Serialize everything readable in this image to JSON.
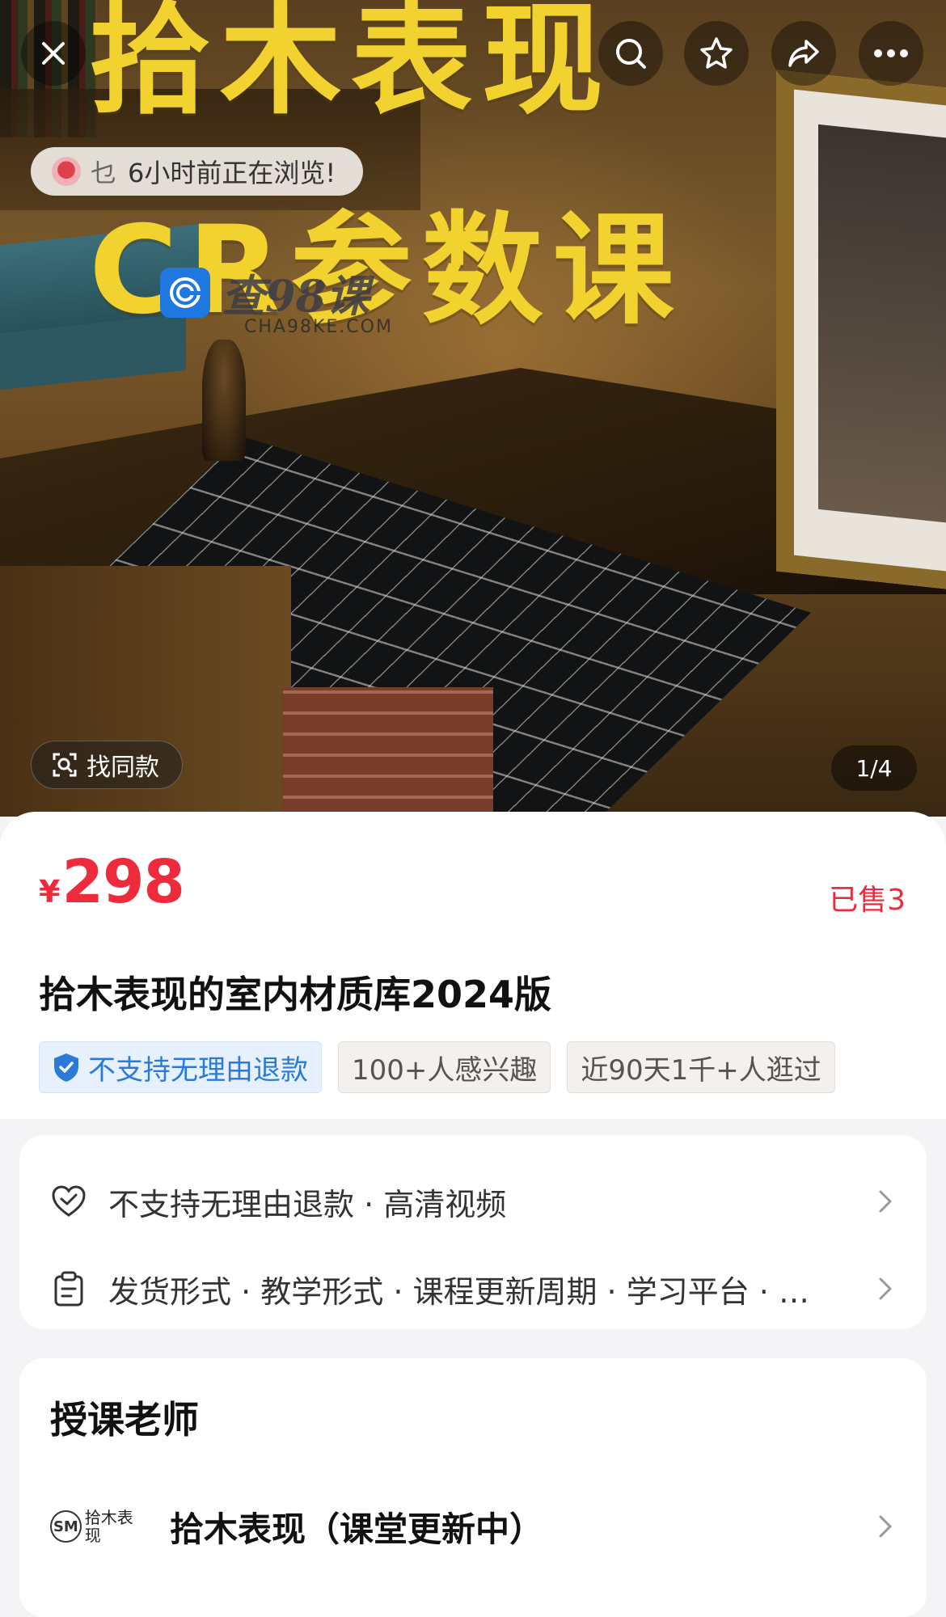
{
  "hero": {
    "title_line1": "拾木表现",
    "title_line2": "CR参数课",
    "watermark_text": "查98课",
    "watermark_url": "CHA98KE.COM",
    "browse_user": "乜",
    "browse_text": "6小时前正在浏览!",
    "find_same_label": "找同款",
    "page_indicator": "1/4"
  },
  "product": {
    "currency": "¥",
    "price": "298",
    "sold": "已售3",
    "title": "拾木表现的室内材质库2024版",
    "tags": [
      {
        "label": "不支持无理由退款",
        "type": "refund"
      },
      {
        "label": "100+人感兴趣",
        "type": "plain"
      },
      {
        "label": "近90天1千+人逛过",
        "type": "plain"
      }
    ]
  },
  "info": {
    "row1": "不支持无理由退款 · 高清视频",
    "row2": "发货形式 · 教学形式 · 课程更新周期 · 学习平台 · …"
  },
  "teacher": {
    "heading": "授课老师",
    "logo_mark": "SM",
    "logo_text": "拾木表现",
    "name": "拾木表现（课堂更新中）"
  },
  "colors": {
    "accent_red": "#ee2b3d",
    "hero_yellow": "#f2d22e",
    "refund_blue": "#2a7ad8"
  },
  "icons": [
    "close-icon",
    "search-icon",
    "star-icon",
    "share-icon",
    "more-icon",
    "scan-icon",
    "shield-icon",
    "heart-check-icon",
    "clipboard-icon",
    "chevron-right-icon"
  ]
}
